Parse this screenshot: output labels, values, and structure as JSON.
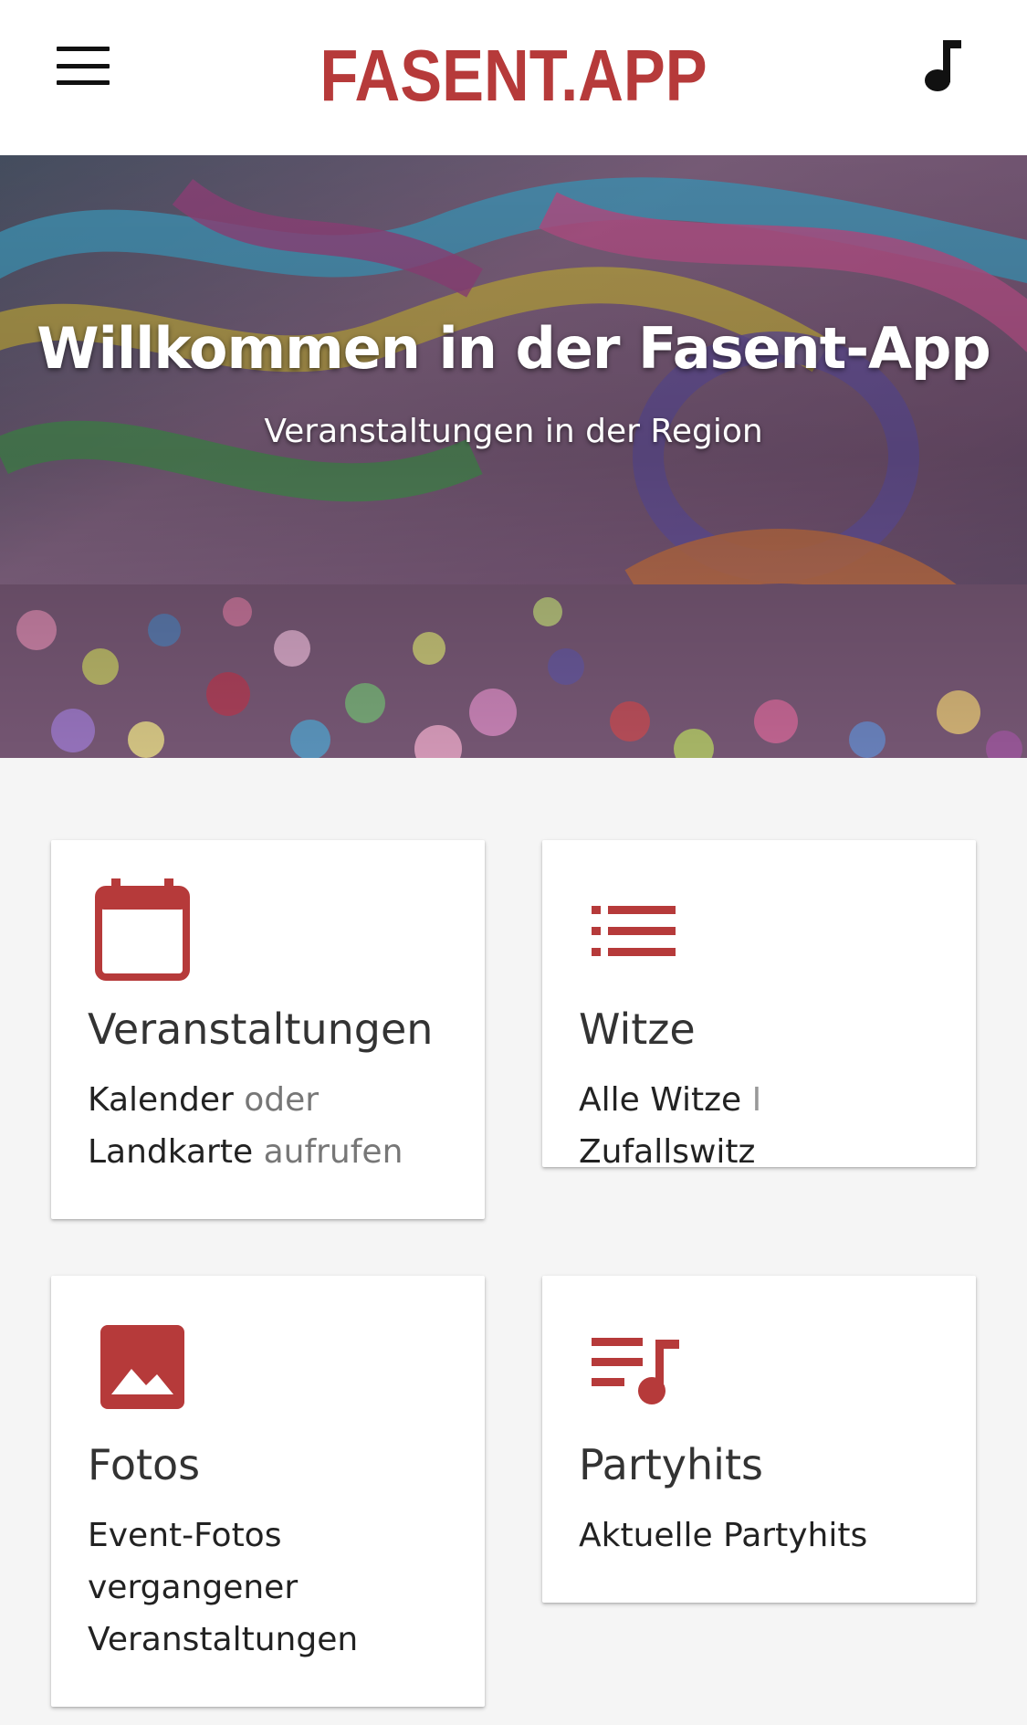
{
  "app_bar": {
    "logo_text": "FASENT.APP",
    "menu_icon": "hamburger-menu-icon",
    "music_icon": "music-note-icon"
  },
  "hero": {
    "title": "Willkommen in der Fasent-App",
    "subtitle": "Veranstaltungen in der Region"
  },
  "cards": {
    "veranstaltungen": {
      "icon": "calendar-icon",
      "title": "Veranstaltungen",
      "link1": "Kalender",
      "joiner": "oder",
      "link2": "Landkarte",
      "suffix": "aufrufen"
    },
    "witze": {
      "icon": "list-icon",
      "title": "Witze",
      "link1": "Alle Witze",
      "separator": "I",
      "link2": "Zufallswitz"
    },
    "fotos": {
      "icon": "image-icon",
      "title": "Fotos",
      "text": "Event-Fotos vergangener Veranstaltungen"
    },
    "partyhits": {
      "icon": "playlist-music-icon",
      "title": "Partyhits",
      "text": "Aktuelle Partyhits"
    }
  },
  "colors": {
    "brand": "#b63a3a",
    "background": "#f5f5f5",
    "card": "#ffffff"
  }
}
